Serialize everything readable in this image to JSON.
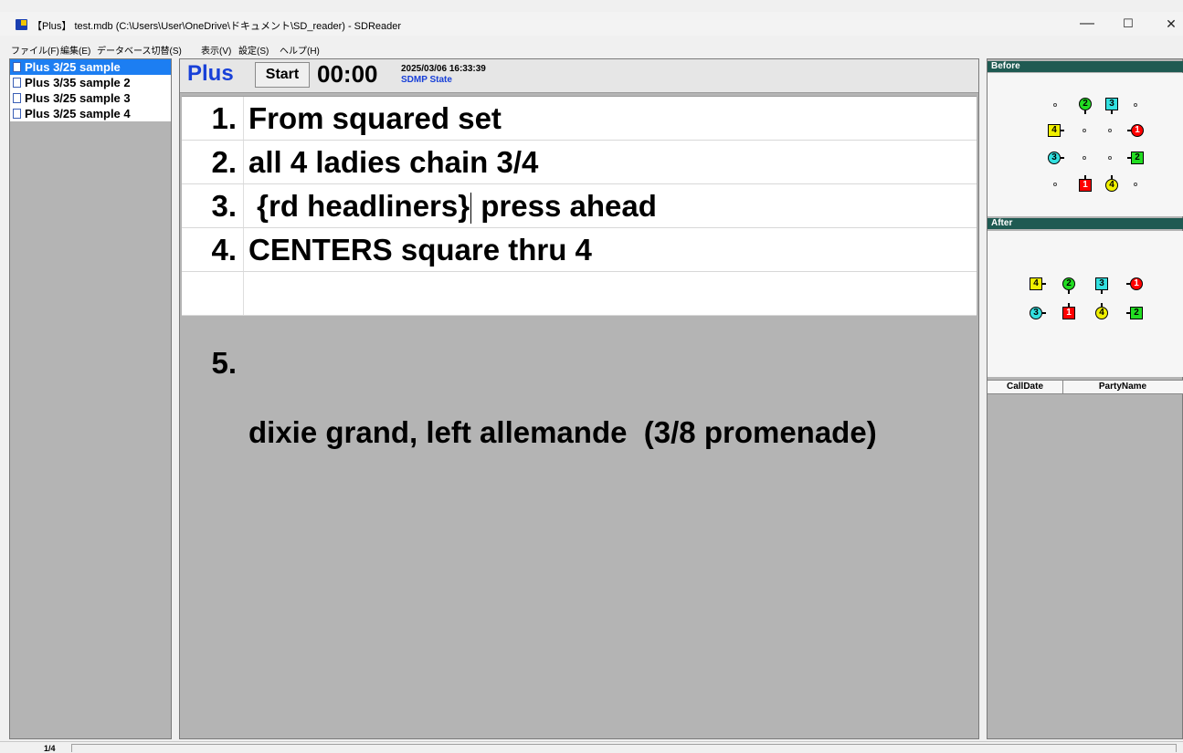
{
  "window": {
    "title": "【Plus】 test.mdb (C:\\Users\\User\\OneDrive\\ドキュメント\\SD_reader) - SDReader",
    "minimize": "—",
    "maximize": "☐",
    "close": "✕"
  },
  "menu": [
    "ファイル(F)",
    "編集(E)",
    "データベース切替(S)",
    "表示(V)",
    "設定(S)",
    "ヘルプ(H)"
  ],
  "sequences": [
    {
      "label": "Plus 3/25 sample",
      "selected": true
    },
    {
      "label": "Plus 3/35 sample 2",
      "selected": false
    },
    {
      "label": "Plus 3/25 sample 3",
      "selected": false
    },
    {
      "label": "Plus 3/25 sample 4",
      "selected": false
    }
  ],
  "header": {
    "level": "Plus",
    "start_label": "Start",
    "timer": "00:00",
    "datetime": "2025/03/06 16:33:39",
    "state": "SDMP State"
  },
  "calls": [
    {
      "num": "1.",
      "text": "From squared set"
    },
    {
      "num": "2.",
      "text": "all 4 ladies chain 3/4"
    },
    {
      "num": "3.",
      "text_before": " {rd headliners}",
      "text_after": " press ahead"
    },
    {
      "num": "4.",
      "text": "CENTERS square thru 4"
    },
    {
      "num": "5.",
      "text": "dixie grand, left allemande  (3/8 promenade)"
    }
  ],
  "formations": {
    "before_label": "Before",
    "after_label": "After",
    "colors": {
      "1": "#ff0000",
      "2": "#22dd22",
      "3": "#33e0e0",
      "4": "#f0f000"
    }
  },
  "history": {
    "columns": [
      "CallDate",
      "PartyName"
    ]
  },
  "status": {
    "page": "1/4"
  }
}
